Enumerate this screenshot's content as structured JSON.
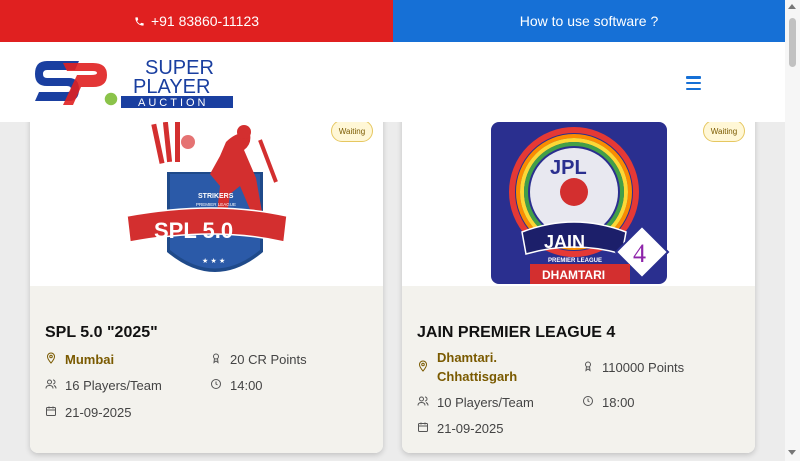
{
  "topbar": {
    "phone": "+91 83860-11123",
    "howto": "How to use software ?"
  },
  "logo": {
    "line1": "SUPER",
    "line2": "PLAYER",
    "line3": "AUCTION"
  },
  "cards": [
    {
      "status": "Waiting",
      "logo_text": "SPL 5.0",
      "logo_sub": "STRIKERS",
      "logo_sub2": "PREMIER LEAGUE",
      "title": "SPL 5.0 \"2025\"",
      "location": "Mumbai",
      "points": "20 CR Points",
      "players": "16 Players/Team",
      "time": "14:00",
      "date": "21-09-2025"
    },
    {
      "status": "Waiting",
      "logo_text": "JPL",
      "logo_sub": "JAIN",
      "logo_sub2": "PREMIER LEAGUE",
      "logo_num": "4",
      "logo_city": "DHAMTARI",
      "title": "JAIN PREMIER LEAGUE 4",
      "location_line1": "Dhamtari.",
      "location_line2": "Chhattisgarh",
      "points": "110000 Points",
      "players": "10 Players/Team",
      "time": "18:00",
      "date": "21-09-2025"
    }
  ],
  "colors": {
    "red": "#e02020",
    "blue": "#1670d6",
    "gold": "#7a5a00"
  }
}
